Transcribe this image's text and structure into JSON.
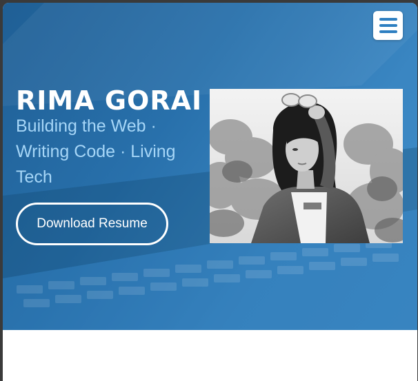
{
  "hero": {
    "name": "RIMA GORAI",
    "tagline": "Building the Web · Writing Code · Living Tech",
    "resume_button_label": "Download Resume",
    "photo_alt": "Portrait of Rima Gorai"
  },
  "nav": {
    "menu_icon": "hamburger-menu-icon",
    "menu_label": "Menu"
  },
  "colors": {
    "hero_blue": "#2870ab",
    "accent_light_blue": "#a6d6f7",
    "menu_icon_blue": "#2e7fc1",
    "text_white": "#ffffff"
  }
}
